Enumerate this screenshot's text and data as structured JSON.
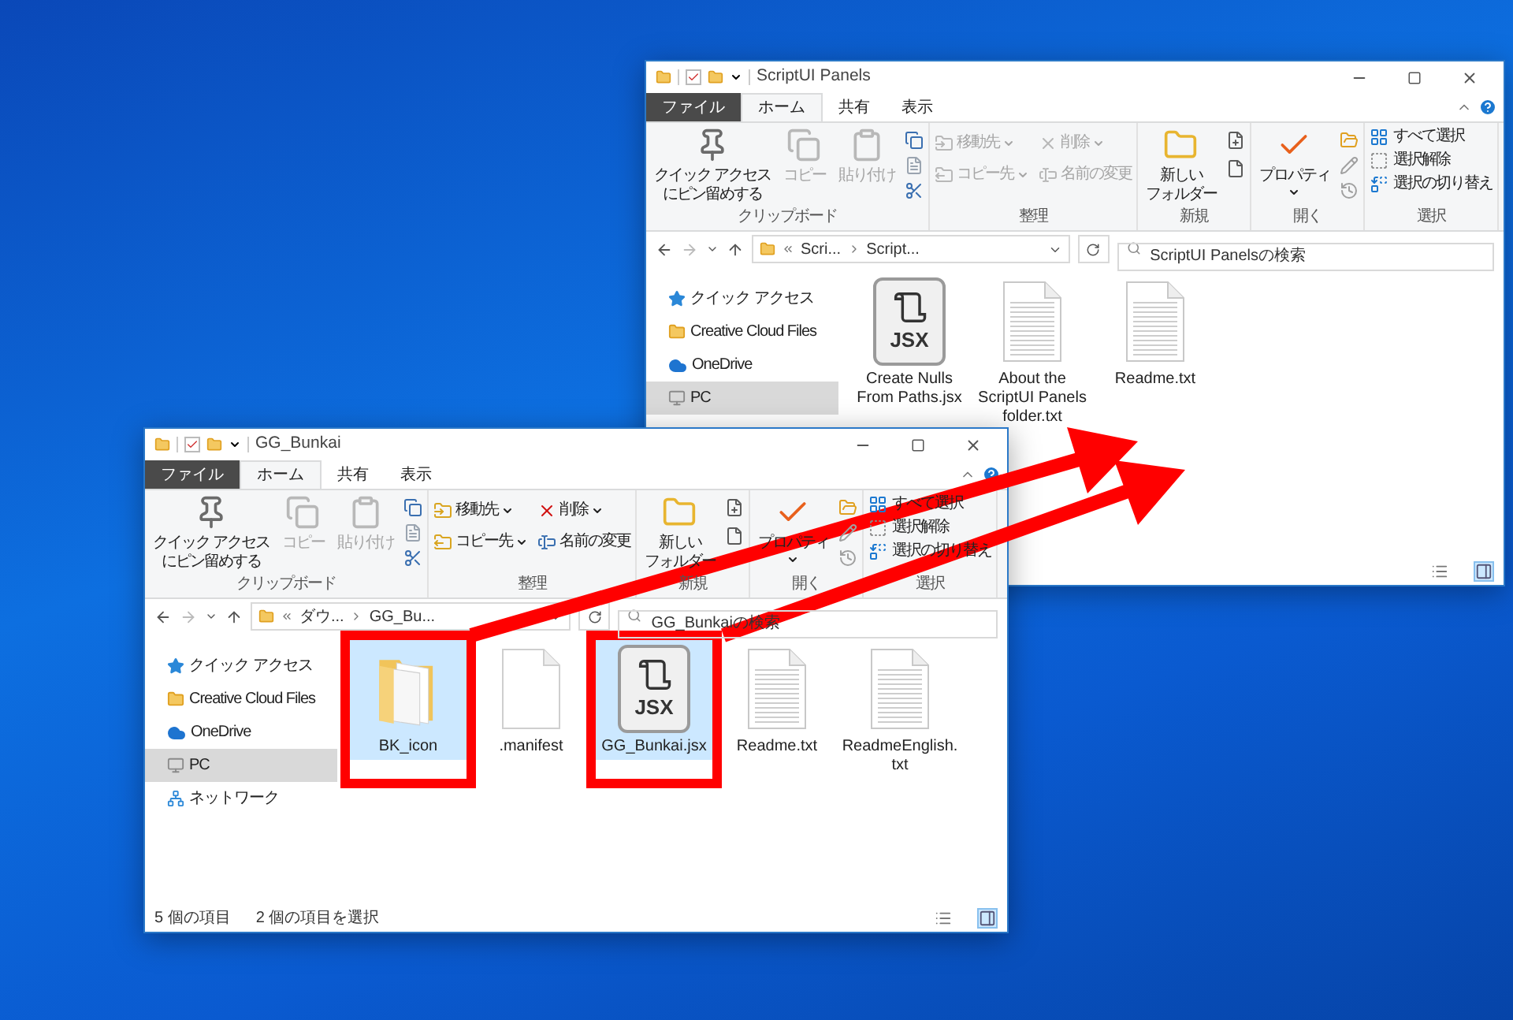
{
  "windows": [
    {
      "title": "ScriptUI Panels",
      "tabs": [
        {
          "label": "ファイル",
          "kind": "file",
          "selected": false
        },
        {
          "label": "ホーム",
          "kind": "tab",
          "selected": true
        },
        {
          "label": "共有",
          "kind": "tab",
          "selected": false
        },
        {
          "label": "表示",
          "kind": "tab",
          "selected": false
        }
      ],
      "ribbon": [
        {
          "label": "クリップボード",
          "kind": "large",
          "buttons": [
            {
              "lines": [
                "クイック アクセス",
                "にピン留めする"
              ],
              "dropdown": false,
              "disabled": false
            },
            {
              "lines": [
                "コピー"
              ],
              "dropdown": false,
              "disabled": true
            },
            {
              "lines": [
                "貼り付け"
              ],
              "dropdown": false,
              "disabled": true
            }
          ]
        },
        {
          "label": "整理",
          "kind": "grid",
          "buttons": [
            {
              "lines": [
                "移動先"
              ],
              "dropdown": true,
              "disabled": true
            },
            {
              "lines": [
                "コピー先"
              ],
              "dropdown": true,
              "disabled": true
            },
            {
              "lines": [
                "削除"
              ],
              "dropdown": true,
              "disabled": true
            },
            {
              "lines": [
                "名前の変更"
              ],
              "dropdown": false,
              "disabled": true
            }
          ]
        },
        {
          "label": "新規",
          "kind": "large",
          "buttons": [
            {
              "lines": [
                "新しい",
                "フォルダー"
              ],
              "dropdown": false,
              "disabled": false
            }
          ]
        },
        {
          "label": "開く",
          "kind": "large",
          "buttons": [
            {
              "lines": [
                "プロパティ"
              ],
              "dropdown": true,
              "disabled": false
            }
          ]
        },
        {
          "label": "選択",
          "kind": "list",
          "buttons": [
            {
              "lines": [
                "すべて選択"
              ],
              "dropdown": false,
              "disabled": false
            },
            {
              "lines": [
                "選択解除"
              ],
              "dropdown": false,
              "disabled": false
            },
            {
              "lines": [
                "選択の切り替え"
              ],
              "dropdown": false,
              "disabled": false
            }
          ]
        }
      ],
      "path": [
        "Scri...",
        "Script..."
      ],
      "search": {
        "placeholder": "ScriptUI Panelsの検索"
      },
      "sidebar": [
        {
          "label": "クイック アクセス",
          "selected": false
        },
        {
          "label": "Creative Cloud Files",
          "selected": false
        },
        {
          "label": "OneDrive",
          "selected": false
        },
        {
          "label": "PC",
          "selected": true
        }
      ],
      "files": [
        {
          "name": "Create Nulls From Paths.jsx",
          "kind": "jsx",
          "badge": "JSX",
          "selected": false,
          "marked": false
        },
        {
          "name": "About the ScriptUI Panels folder.txt",
          "kind": "text",
          "selected": false,
          "marked": false
        },
        {
          "name": "Readme.txt",
          "kind": "text",
          "selected": false,
          "marked": false
        }
      ]
    },
    {
      "title": "GG_Bunkai",
      "tabs": [
        {
          "label": "ファイル",
          "kind": "file",
          "selected": false
        },
        {
          "label": "ホーム",
          "kind": "tab",
          "selected": true
        },
        {
          "label": "共有",
          "kind": "tab",
          "selected": false
        },
        {
          "label": "表示",
          "kind": "tab",
          "selected": false
        }
      ],
      "ribbon": [
        {
          "label": "クリップボード",
          "kind": "large",
          "buttons": [
            {
              "lines": [
                "クイック アクセス",
                "にピン留めする"
              ],
              "dropdown": false,
              "disabled": false
            },
            {
              "lines": [
                "コピー"
              ],
              "dropdown": false,
              "disabled": true
            },
            {
              "lines": [
                "貼り付け"
              ],
              "dropdown": false,
              "disabled": true
            }
          ]
        },
        {
          "label": "整理",
          "kind": "grid",
          "buttons": [
            {
              "lines": [
                "移動先"
              ],
              "dropdown": true,
              "disabled": false
            },
            {
              "lines": [
                "コピー先"
              ],
              "dropdown": true,
              "disabled": false
            },
            {
              "lines": [
                "削除"
              ],
              "dropdown": true,
              "disabled": false
            },
            {
              "lines": [
                "名前の変更"
              ],
              "dropdown": false,
              "disabled": false
            }
          ]
        },
        {
          "label": "新規",
          "kind": "large",
          "buttons": [
            {
              "lines": [
                "新しい",
                "フォルダー"
              ],
              "dropdown": false,
              "disabled": false
            }
          ]
        },
        {
          "label": "開く",
          "kind": "large",
          "buttons": [
            {
              "lines": [
                "プロパティ"
              ],
              "dropdown": true,
              "disabled": false
            }
          ]
        },
        {
          "label": "選択",
          "kind": "list",
          "buttons": [
            {
              "lines": [
                "すべて選択"
              ],
              "dropdown": false,
              "disabled": false
            },
            {
              "lines": [
                "選択解除"
              ],
              "dropdown": false,
              "disabled": false
            },
            {
              "lines": [
                "選択の切り替え"
              ],
              "dropdown": false,
              "disabled": false
            }
          ]
        }
      ],
      "path": [
        "ダウ...",
        "GG_Bu..."
      ],
      "search": {
        "placeholder": "GG_Bunkaiの検索"
      },
      "sidebar": [
        {
          "label": "クイック アクセス",
          "selected": false
        },
        {
          "label": "Creative Cloud Files",
          "selected": false
        },
        {
          "label": "OneDrive",
          "selected": false
        },
        {
          "label": "PC",
          "selected": true
        },
        {
          "label": "ネットワーク",
          "selected": false
        }
      ],
      "files": [
        {
          "name": "BK_icon",
          "kind": "folder",
          "selected": true,
          "marked": true
        },
        {
          "name": ".manifest",
          "kind": "blank",
          "selected": false,
          "marked": false
        },
        {
          "name": "GG_Bunkai.jsx",
          "kind": "jsx",
          "badge": "JSX",
          "selected": true,
          "marked": true
        },
        {
          "name": "Readme.txt",
          "kind": "text",
          "selected": false,
          "marked": false
        },
        {
          "name": "ReadmeEnglish.txt",
          "kind": "text",
          "selected": false,
          "marked": false
        }
      ],
      "status": [
        "5 個の項目",
        "2 個の項目を選択"
      ]
    }
  ]
}
